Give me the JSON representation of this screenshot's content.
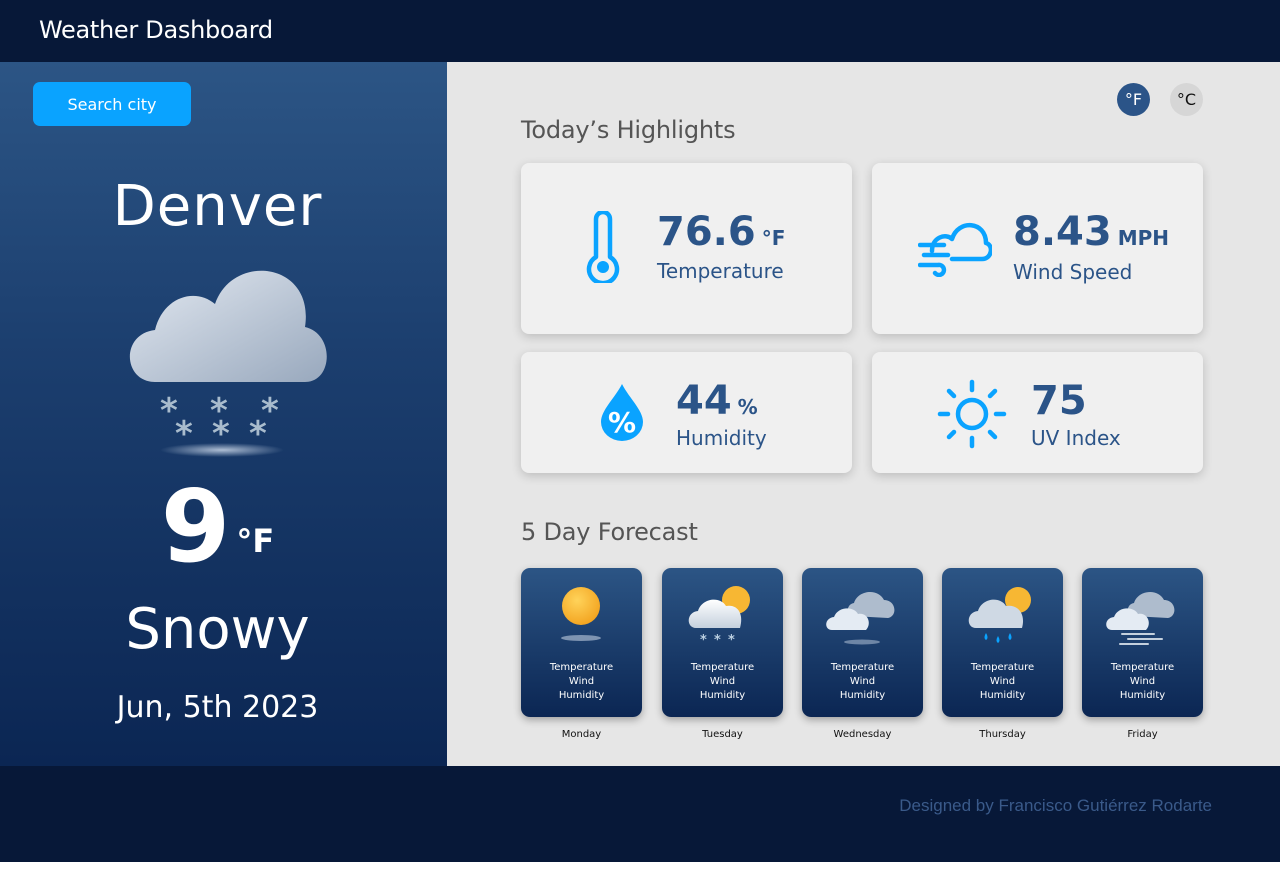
{
  "header": {
    "title": "Weather Dashboard"
  },
  "sidebar": {
    "search_label": "Search city",
    "city": "Denver",
    "temperature": "9",
    "temperature_unit": "°F",
    "condition": "Snowy",
    "date": "Jun, 5th 2023",
    "icon": "snow-cloud-icon"
  },
  "units": {
    "fahrenheit": "°F",
    "celsius": "°C",
    "selected": "fahrenheit"
  },
  "highlights": {
    "title": "Today’s Highlights",
    "temperature": {
      "value": "76.6",
      "unit": "°F",
      "label": "Temperature",
      "icon": "thermometer-icon"
    },
    "wind": {
      "value": "8.43",
      "unit": "MPH",
      "label": "Wind Speed",
      "icon": "wind-cloud-icon"
    },
    "humidity": {
      "value": "44",
      "unit": "%",
      "label": "Humidity",
      "icon": "humidity-drop-icon"
    },
    "uv": {
      "value": "75",
      "label": "UV Index",
      "icon": "sun-icon"
    }
  },
  "forecast": {
    "title": "5 Day Forecast",
    "line_labels": {
      "temperature": "Temperature",
      "wind": "Wind",
      "humidity": "Humidity"
    },
    "days": [
      {
        "day": "Monday",
        "icon": "sun-icon"
      },
      {
        "day": "Tuesday",
        "icon": "sun-snow-cloud-icon"
      },
      {
        "day": "Wednesday",
        "icon": "cloudy-icon"
      },
      {
        "day": "Thursday",
        "icon": "sun-rain-cloud-icon"
      },
      {
        "day": "Friday",
        "icon": "windy-cloud-icon"
      }
    ]
  },
  "footer": {
    "credit": "Designed by Francisco Gutiérrez Rodarte"
  },
  "colors": {
    "accent": "#0aa3ff",
    "navy": "#071838",
    "primary": "#2b5488"
  }
}
